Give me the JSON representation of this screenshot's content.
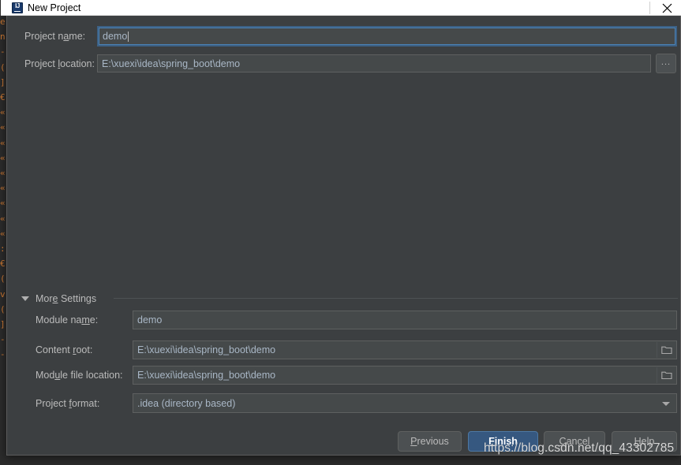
{
  "window": {
    "title": "New Project",
    "app_icon": "intellij-idea-icon",
    "close_icon": "close-icon"
  },
  "form": {
    "project_name": {
      "label_pre": "Project n",
      "label_mnemonic": "a",
      "label_post": "me:",
      "value": "demo"
    },
    "project_location": {
      "label_pre": "Project ",
      "label_mnemonic": "l",
      "label_post": "ocation:",
      "value": "E:\\xuexi\\idea\\spring_boot\\demo"
    },
    "browse_button_label": "..."
  },
  "more_settings": {
    "title_pre": "Mor",
    "title_mnemonic": "e",
    "title_post": " Settings",
    "expanded": true,
    "module_name": {
      "label_pre": "Module na",
      "label_mnemonic": "m",
      "label_post": "e:",
      "value": "demo"
    },
    "content_root": {
      "label_pre": "Content ",
      "label_mnemonic": "r",
      "label_post": "oot:",
      "value": "E:\\xuexi\\idea\\spring_boot\\demo"
    },
    "module_file_location": {
      "label_pre": "Mod",
      "label_mnemonic": "u",
      "label_post": "le file location:",
      "value": "E:\\xuexi\\idea\\spring_boot\\demo"
    },
    "project_format": {
      "label_pre": "Project ",
      "label_mnemonic": "f",
      "label_post": "ormat:",
      "value": ".idea (directory based)"
    }
  },
  "buttons": {
    "previous": {
      "pre": "",
      "mnemonic": "P",
      "post": "revious"
    },
    "finish": {
      "pre": "",
      "mnemonic": "F",
      "post": "inish"
    },
    "cancel": {
      "pre": "",
      "mnemonic": "C",
      "post": "ancel"
    },
    "help": {
      "pre": "",
      "mnemonic": "H",
      "post": "elp"
    }
  },
  "watermark": "https://blog.csdn.net/qq_43302785",
  "background_code": "e\nn\n-\n(\n]\n€\n«\n«\n«\n«\n«\n«\n«\n«\n«\n:\n€\n(\nv\n(\n]\n-\n-",
  "colors": {
    "dialog_bg": "#3c3f41",
    "field_bg": "#45494a",
    "text": "#bbbbbb",
    "value_text": "#a9b7c6",
    "accent_default_button": "#365880",
    "focus_border": "#4b81b3",
    "titlebar_bg": "#ffffff",
    "desktop_bg": "#2f3a31"
  }
}
